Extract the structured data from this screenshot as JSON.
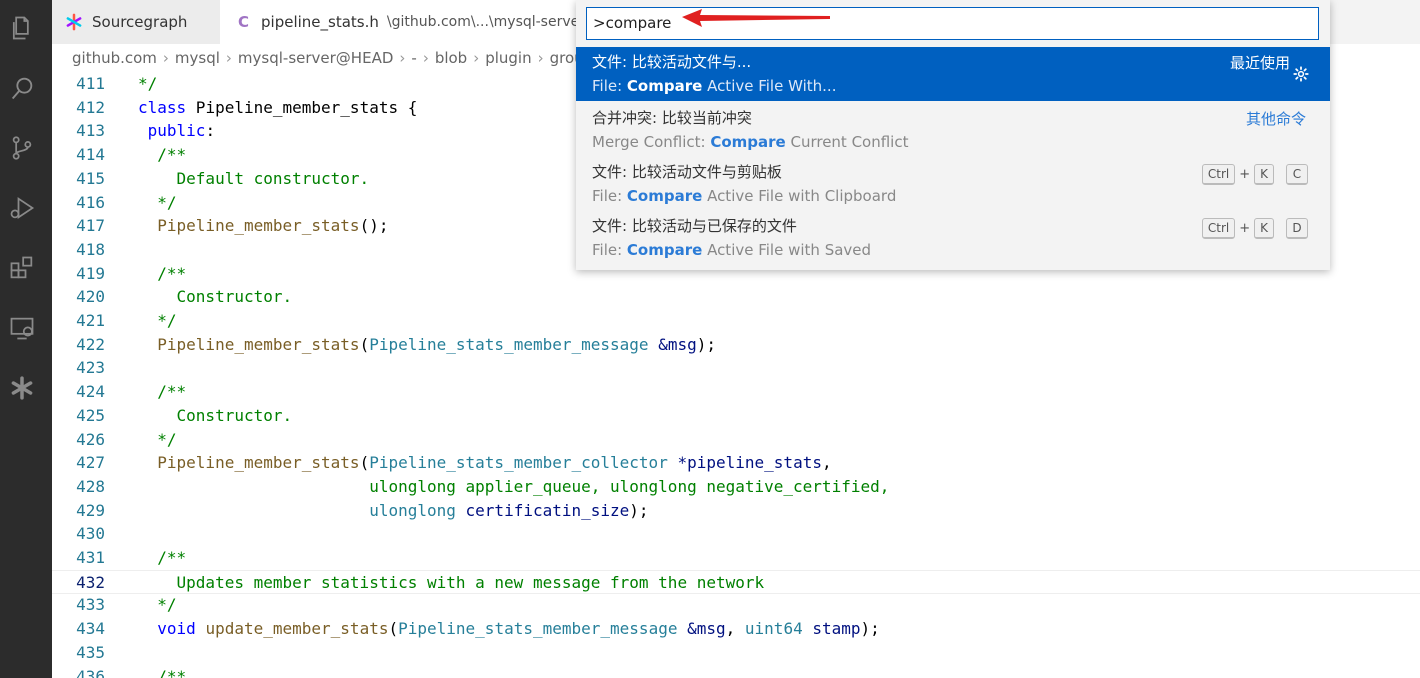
{
  "tabs": [
    {
      "label": "Sourcegraph",
      "icon": "sourcegraph-icon"
    },
    {
      "label": "pipeline_stats.h",
      "lang_badge": "C",
      "path": "\\github.com\\...\\mysql-server@h"
    }
  ],
  "breadcrumb": [
    "github.com",
    "mysql",
    "mysql-server@HEAD",
    "-",
    "blob",
    "plugin",
    "grou"
  ],
  "activity_icons": [
    "explorer-icon",
    "search-icon",
    "source-control-icon",
    "run-debug-icon",
    "extensions-icon",
    "remote-explorer-icon",
    "sourcegraph-star-icon"
  ],
  "command_palette": {
    "input_value": ">compare",
    "items": [
      {
        "zh": "文件: 比较活动文件与...",
        "en_prefix": "File: ",
        "en_bold": "Compare",
        "en_rest": " Active File With...",
        "right": "最近使用",
        "selected": true
      },
      {
        "zh": "合并冲突: 比较当前冲突",
        "en_prefix": "Merge Conflict: ",
        "en_bold": "Compare",
        "en_rest": " Current Conflict",
        "right": "其他命令"
      },
      {
        "zh": "文件: 比较活动文件与剪贴板",
        "en_prefix": "File: ",
        "en_bold": "Compare",
        "en_rest": " Active File with Clipboard",
        "keys": [
          "Ctrl",
          "K",
          "C"
        ]
      },
      {
        "zh": "文件: 比较活动与已保存的文件",
        "en_prefix": "File: ",
        "en_bold": "Compare",
        "en_rest": " Active File with Saved",
        "keys": [
          "Ctrl",
          "K",
          "D"
        ]
      }
    ]
  },
  "code_lines": [
    {
      "n": "411",
      "text": "*/"
    },
    {
      "n": "412",
      "text": "class Pipeline_member_stats {"
    },
    {
      "n": "413",
      "text": " public:"
    },
    {
      "n": "414",
      "text": "  /**"
    },
    {
      "n": "415",
      "text": "    Default constructor."
    },
    {
      "n": "416",
      "text": "  */"
    },
    {
      "n": "417",
      "text": "  Pipeline_member_stats();"
    },
    {
      "n": "418",
      "text": ""
    },
    {
      "n": "419",
      "text": "  /**"
    },
    {
      "n": "420",
      "text": "    Constructor."
    },
    {
      "n": "421",
      "text": "  */"
    },
    {
      "n": "422",
      "text": "  Pipeline_member_stats(Pipeline_stats_member_message &msg);"
    },
    {
      "n": "423",
      "text": ""
    },
    {
      "n": "424",
      "text": "  /**"
    },
    {
      "n": "425",
      "text": "    Constructor."
    },
    {
      "n": "426",
      "text": "  */"
    },
    {
      "n": "427",
      "text": "  Pipeline_member_stats(Pipeline_stats_member_collector *pipeline_stats,"
    },
    {
      "n": "428",
      "text": "                        ulonglong applier_queue, ulonglong negative_certified,"
    },
    {
      "n": "429",
      "text": "                        ulonglong certificatin_size);"
    },
    {
      "n": "430",
      "text": ""
    },
    {
      "n": "431",
      "text": "  /**"
    },
    {
      "n": "432",
      "text": "    Updates member statistics with a new message from the network"
    },
    {
      "n": "433",
      "text": "  */"
    },
    {
      "n": "434",
      "text": "  void update_member_stats(Pipeline_stats_member_message &msg, uint64 stamp);"
    },
    {
      "n": "435",
      "text": ""
    },
    {
      "n": "436",
      "text": "  /**"
    }
  ],
  "active_line": "432",
  "colors": {
    "activity_bar": "#2c2c2c",
    "selection": "#0060c0",
    "highlight": "#2b7bd6",
    "line_number": "#237893",
    "arrow": "#e02020"
  }
}
